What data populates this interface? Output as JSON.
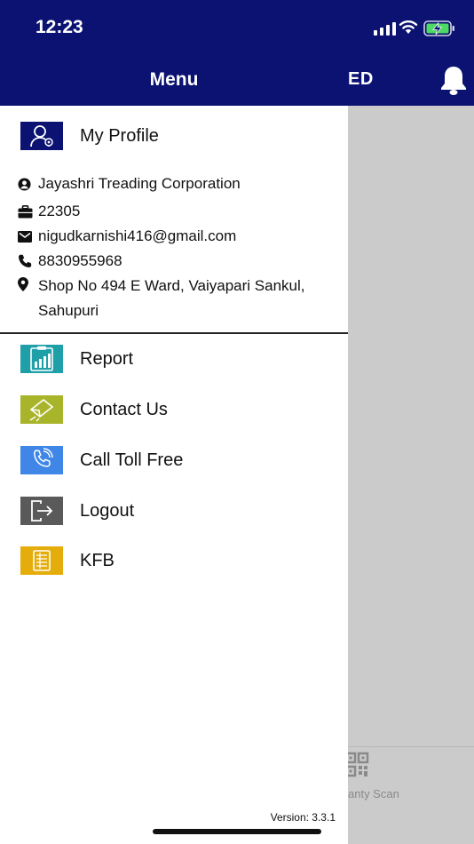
{
  "status_bar": {
    "time": "12:23"
  },
  "background_app": {
    "title_fragment": "ED",
    "bottom_nav_label": "anty Scan"
  },
  "drawer": {
    "title": "Menu",
    "profile": {
      "label": "My Profile",
      "company": "Jayashri Treading Corporation",
      "code": "22305",
      "email": "nigudkarnishi416@gmail.com",
      "phone": "8830955968",
      "address": "Shop No 494 E Ward, Vaiyapari Sankul, Sahupuri"
    },
    "items": [
      {
        "label": "Report",
        "icon": "report-icon",
        "color": "#1f9fa8"
      },
      {
        "label": "Contact Us",
        "icon": "contact-icon",
        "color": "#a8b52a"
      },
      {
        "label": "Call Toll Free",
        "icon": "phone-call-icon",
        "color": "#3f86e6"
      },
      {
        "label": "Logout",
        "icon": "logout-icon",
        "color": "#5a5a5a"
      },
      {
        "label": "KFB",
        "icon": "kfb-icon",
        "color": "#e4ad0c"
      }
    ],
    "version": "Version: 3.3.1"
  },
  "colors": {
    "header": "#0b1272",
    "overlay": "#cbcbcb",
    "profile_tile": "#0b1272"
  }
}
